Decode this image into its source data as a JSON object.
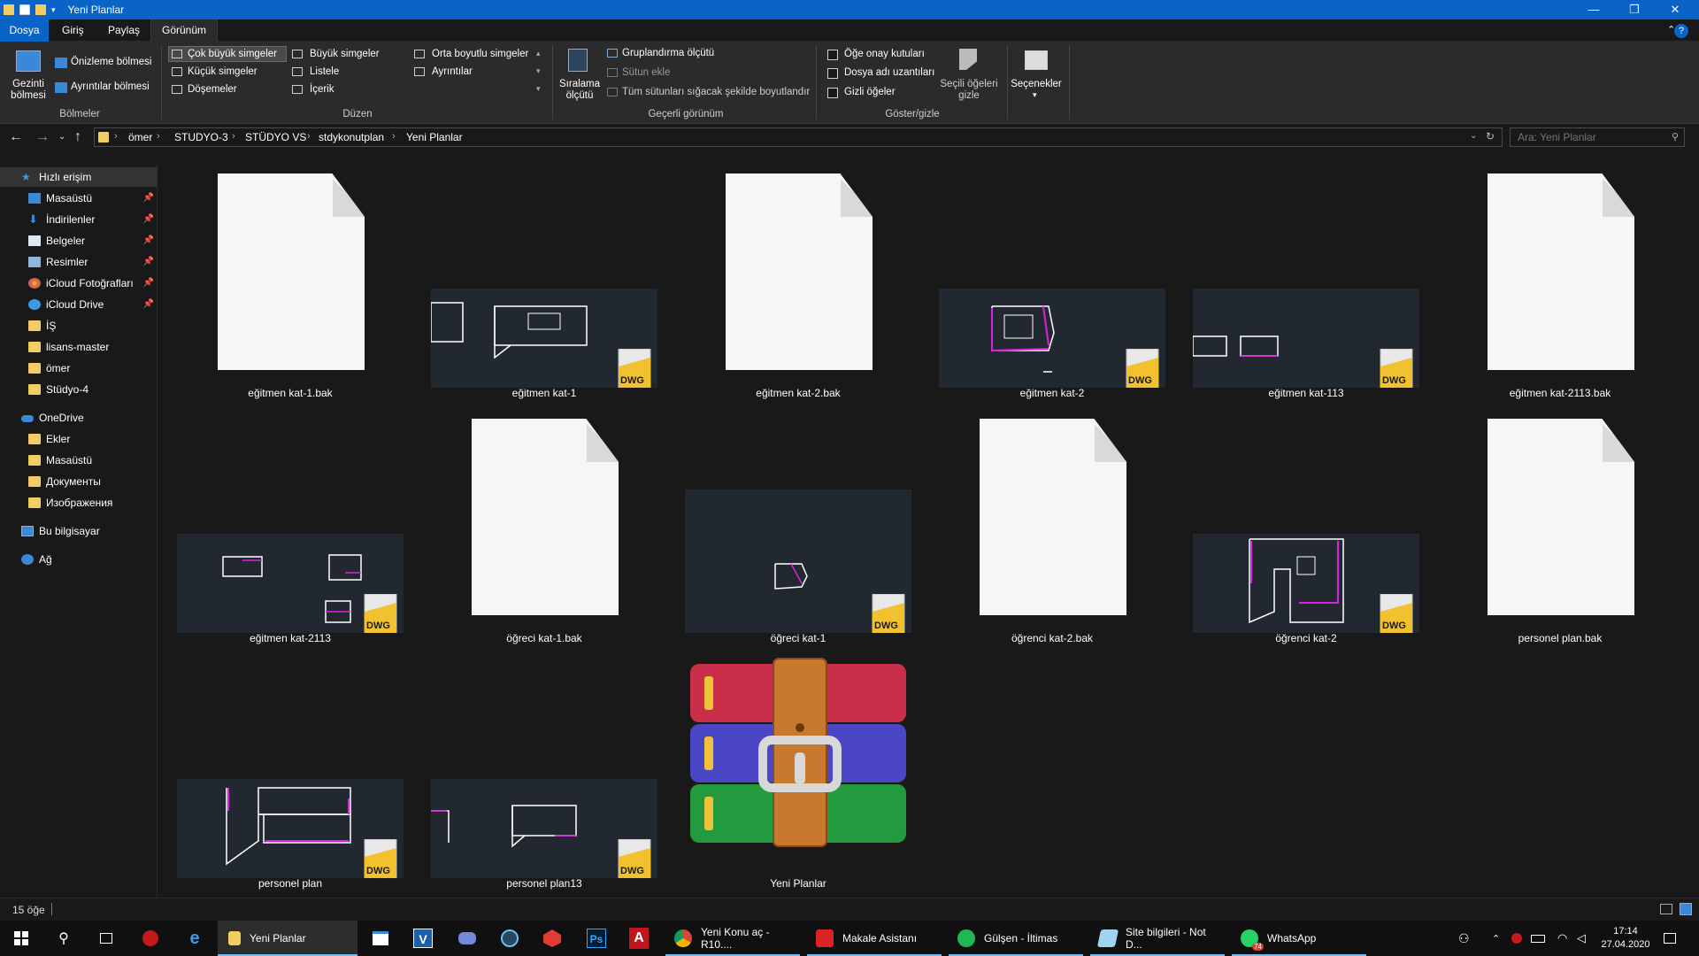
{
  "window": {
    "title": "Yeni Planlar"
  },
  "ribbon_tabs": [
    "Dosya",
    "Giriş",
    "Paylaş",
    "Görünüm"
  ],
  "ribbon": {
    "panes": {
      "nav_pane_label": "Gezinti bölmesi",
      "preview": "Önizleme bölmesi",
      "details": "Ayrıntılar bölmesi",
      "group": "Bölmeler"
    },
    "layout": {
      "items": [
        "Çok büyük simgeler",
        "Büyük simgeler",
        "Orta boyutlu simgeler",
        "Küçük simgeler",
        "Listele",
        "Ayrıntılar",
        "Döşemeler",
        "İçerik"
      ],
      "group": "Düzen"
    },
    "current_view": {
      "sort_label": "Sıralama ölçütü",
      "group_by": "Gruplandırma ölçütü",
      "add_column": "Sütun ekle",
      "fit_columns": "Tüm sütunları sığacak şekilde boyutlandır",
      "group": "Geçerli görünüm"
    },
    "show_hide": {
      "item_checkboxes": "Öğe onay kutuları",
      "file_extensions": "Dosya adı uzantıları",
      "hidden_items": "Gizli öğeler",
      "hide_selected": "Seçili öğeleri gizle",
      "group": "Göster/gizle"
    },
    "options": "Seçenekler"
  },
  "address": {
    "crumbs": [
      "ömer",
      "STUDYO-3",
      "STÜDYO VS",
      "stdykonutplan",
      "Yeni Planlar"
    ],
    "search_placeholder": "Ara: Yeni Planlar"
  },
  "sidebar": {
    "quick_access": "Hızlı erişim",
    "pinned": [
      "Masaüstü",
      "İndirilenler",
      "Belgeler",
      "Resimler",
      "iCloud Fotoğrafları",
      "iCloud Drive"
    ],
    "folders": [
      "İŞ",
      "lisans-master",
      "ömer",
      "Stüdyo-4"
    ],
    "onedrive": "OneDrive",
    "onedrive_items": [
      "Ekler",
      "Masaüstü",
      "Документы",
      "Изображения"
    ],
    "this_pc": "Bu bilgisayar",
    "network": "Ağ"
  },
  "files": [
    {
      "name": "eğitmen kat-1.bak",
      "type": "bak"
    },
    {
      "name": "eğitmen kat-1",
      "type": "dwg"
    },
    {
      "name": "eğitmen kat-2.bak",
      "type": "bak"
    },
    {
      "name": "eğitmen kat-2",
      "type": "dwg"
    },
    {
      "name": "eğitmen kat-113",
      "type": "dwg"
    },
    {
      "name": "eğitmen kat-2113.bak",
      "type": "bak"
    },
    {
      "name": "eğitmen kat-2113",
      "type": "dwg"
    },
    {
      "name": "öğreci kat-1.bak",
      "type": "bak"
    },
    {
      "name": "öğreci kat-1",
      "type": "dwg"
    },
    {
      "name": "öğrenci kat-2.bak",
      "type": "bak"
    },
    {
      "name": "öğrenci kat-2",
      "type": "dwg"
    },
    {
      "name": "personel plan.bak",
      "type": "bak"
    },
    {
      "name": "personel plan",
      "type": "dwg"
    },
    {
      "name": "personel plan13",
      "type": "dwg"
    },
    {
      "name": "Yeni Planlar",
      "type": "rar"
    }
  ],
  "dwg_badge": "DWG",
  "status": {
    "count": "15 öğe"
  },
  "taskbar": {
    "apps": [
      "Yeni Planlar",
      "Yeni Konu aç - R10....",
      "Makale Asistanı",
      "Gülşen - İltimas",
      "Site bilgileri - Not D...",
      "WhatsApp"
    ],
    "time": "17:14",
    "date": "27.04.2020",
    "whatsapp_badge": "74"
  },
  "colors": {
    "accent": "#0a64c8",
    "folder": "#f4cd62",
    "cad_magenta": "#e020e0"
  }
}
